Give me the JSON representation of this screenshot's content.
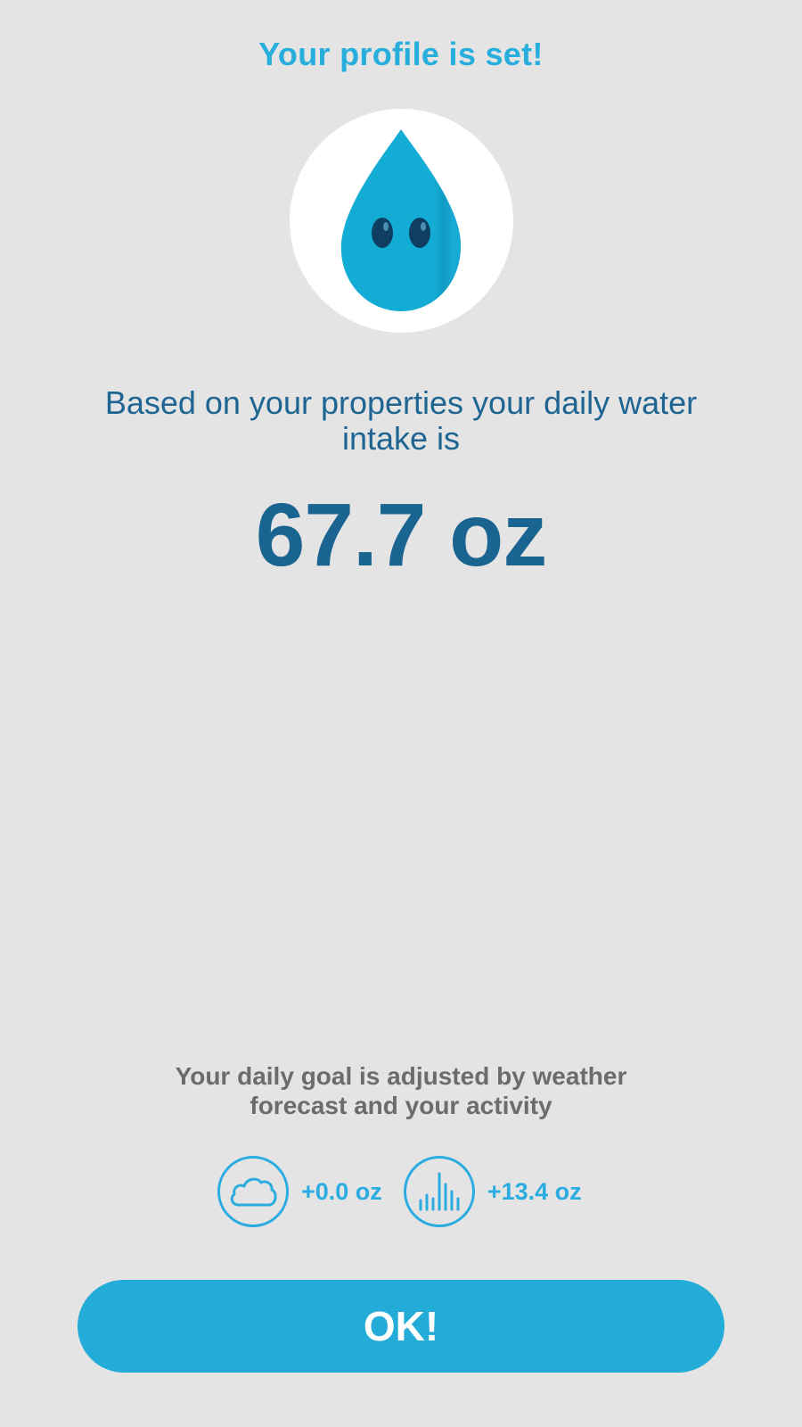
{
  "header": {
    "title": "Your profile is set!"
  },
  "mascot": {
    "icon": "water-drop-mascot-icon",
    "colors": {
      "drop": "#13acd5",
      "eyes": "#0e3f62",
      "circle": "#ffffff"
    }
  },
  "intake": {
    "description": "Based on your properties your daily water intake is",
    "value": "67.7 oz"
  },
  "adjustments": {
    "description": "Your daily goal is adjusted by weather forecast and your activity",
    "weather": {
      "icon": "cloud-icon",
      "value": "+0.0 oz"
    },
    "activity": {
      "icon": "activity-bars-icon",
      "value": "+13.4 oz"
    }
  },
  "actions": {
    "ok_label": "OK!"
  },
  "colors": {
    "background": "#e4e4e5",
    "accent": "#23acd8",
    "dark_blue": "#1a6491",
    "gray_text": "#6c6c6c"
  }
}
